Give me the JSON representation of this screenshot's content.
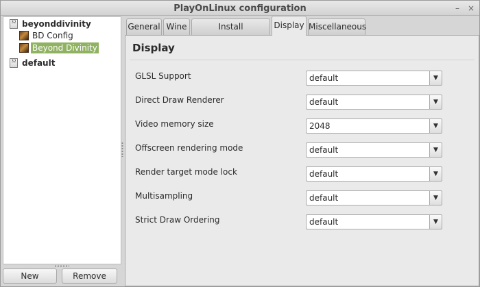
{
  "window": {
    "title": "PlayOnLinux configuration",
    "minimize_glyph": "–",
    "close_glyph": "×"
  },
  "tree": {
    "items": [
      {
        "label": "beyonddivinity",
        "icon": "prefix-32-icon",
        "icon_text": "32",
        "bold": true
      },
      {
        "label": "BD Config",
        "icon": "game-icon"
      },
      {
        "label": "Beyond Divinity",
        "icon": "game-icon",
        "selected": true
      },
      {
        "label": "default",
        "icon": "prefix-32-icon",
        "icon_text": "32",
        "bold": true
      }
    ]
  },
  "buttons": {
    "new": "New",
    "remove": "Remove"
  },
  "tabs": [
    {
      "label": "General"
    },
    {
      "label": "Wine"
    },
    {
      "label": "Install components"
    },
    {
      "label": "Display",
      "active": true
    },
    {
      "label": "Miscellaneous"
    }
  ],
  "display": {
    "heading": "Display",
    "arrow_glyph": "▼",
    "settings": [
      {
        "label": "GLSL Support",
        "value": "default"
      },
      {
        "label": "Direct Draw Renderer",
        "value": "default"
      },
      {
        "label": "Video memory size",
        "value": "2048"
      },
      {
        "label": "Offscreen rendering mode",
        "value": "default"
      },
      {
        "label": "Render target mode lock",
        "value": "default"
      },
      {
        "label": "Multisampling",
        "value": "default"
      },
      {
        "label": "Strict Draw Ordering",
        "value": "default"
      }
    ]
  },
  "colors": {
    "selection": "#90b262",
    "window_bg": "#d6d6d6",
    "panel_bg": "#eaeaea"
  }
}
